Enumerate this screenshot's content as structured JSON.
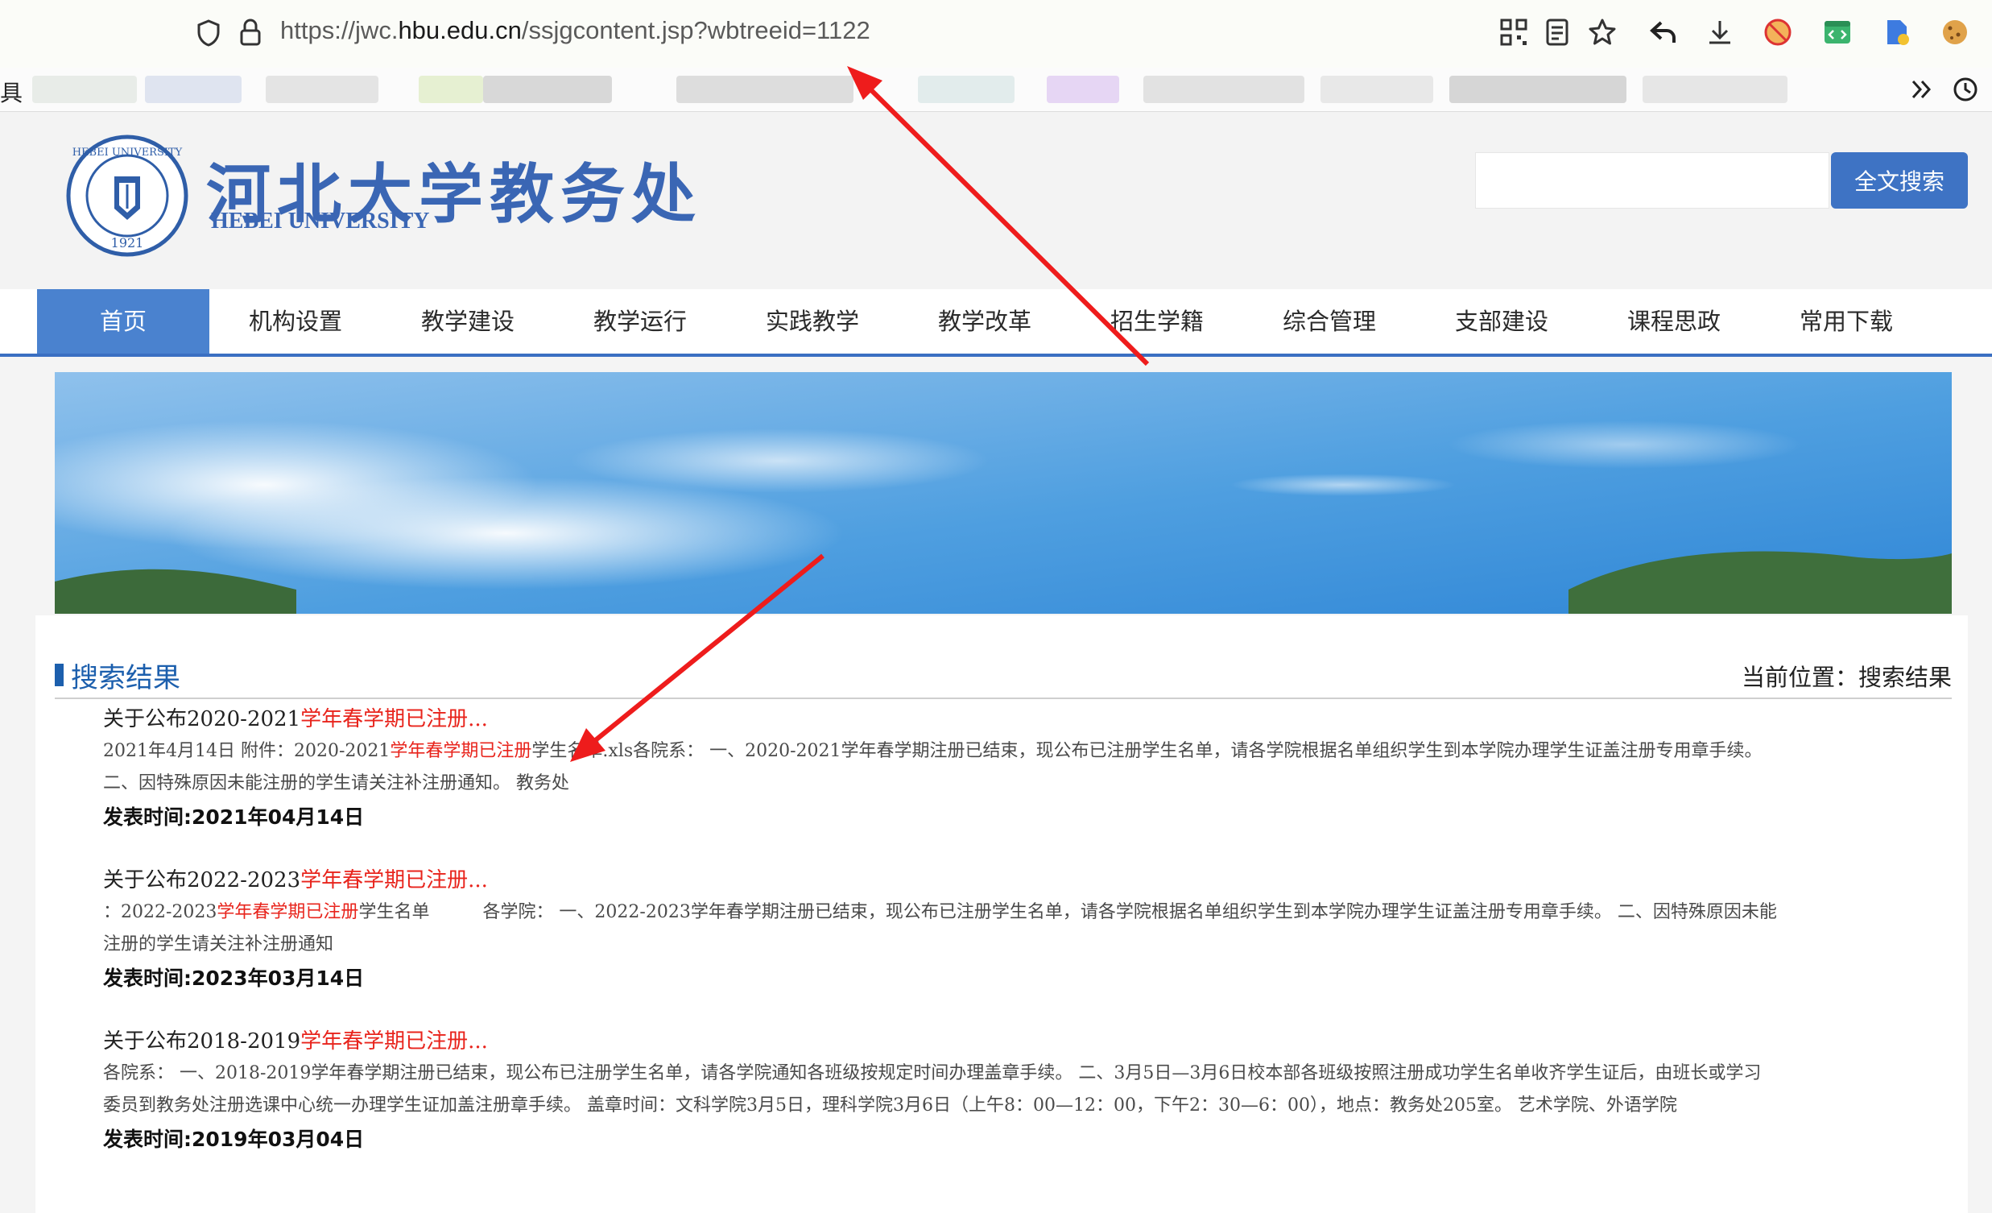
{
  "browser": {
    "url_prefix": "https://jwc.",
    "url_domain": "hbu.edu.cn",
    "url_path": "/ssjgcontent.jsp?wbtreeid=1122",
    "bookmarks_left_glyph": "具"
  },
  "header": {
    "logo_cn": "河北大学教务处",
    "logo_en": "HEBEI UNIVERSITY",
    "logo_seal_year": "1921",
    "logo_seal_ring": "HEBEI UNIVERSITY",
    "search_placeholder": "",
    "search_button": "全文搜索"
  },
  "nav": {
    "items": [
      "首页",
      "机构设置",
      "教学建设",
      "教学运行",
      "实践教学",
      "教学改革",
      "招生学籍",
      "综合管理",
      "支部建设",
      "课程思政",
      "常用下载"
    ],
    "active_index": 0
  },
  "content": {
    "section_title": "搜索结果",
    "breadcrumb": "当前位置：搜索结果",
    "results": [
      {
        "title_before": "关于公布2020-2021",
        "title_highlight": "学年春学期已注册...",
        "body_1a": "2021年4月14日 附件：2020-2021",
        "body_1hl": "学年春学期已注册",
        "body_1b": "学生名单.xls各院系： 一、2020-2021学年春学期注册已结束，现公布已注册学生名单，请各学院根据名单组织学生到本学院办理学生证盖注册专用章手续。",
        "body_2": "二、因特殊原因未能注册的学生请关注补注册通知。 教务处",
        "date": "发表时间:2021年04月14日"
      },
      {
        "title_before": "关于公布2022-2023",
        "title_highlight": "学年春学期已注册...",
        "body_1a": "：2022-2023",
        "body_1hl": "学年春学期已注册",
        "body_1b": "学生名单　　　各学院： 一、2022-2023学年春学期注册已结束，现公布已注册学生名单，请各学院根据名单组织学生到本学院办理学生证盖注册专用章手续。 二、因特殊原因未能",
        "body_2": "注册的学生请关注补注册通知",
        "date": "发表时间:2023年03月14日"
      },
      {
        "title_before": "关于公布2018-2019",
        "title_highlight": "学年春学期已注册...",
        "body_1a": "各院系： 一、2018-2019学年春学期注册已结束，现公布已注册学生名单，请各学院通知各班级按规定时间办理盖章手续。 二、3月5日—3月6日校本部各班级按照注册成功学生名单收齐学生证后，由班长或学习",
        "body_1hl": "",
        "body_1b": "",
        "body_2": "委员到教务处注册选课中心统一办理学生证加盖注册章手续。 盖章时间：文科学院3月5日，理科学院3月6日（上午8：00—12：00，下午2：30—6：00），地点：教务处205室。 艺术学院、外语学院",
        "date": "发表时间:2019年03月04日"
      }
    ]
  },
  "colors": {
    "brand_blue": "#3a66b4",
    "nav_active": "#4a82cf",
    "highlight_red": "#e8241c",
    "annotation_red": "#ee1c1c"
  }
}
